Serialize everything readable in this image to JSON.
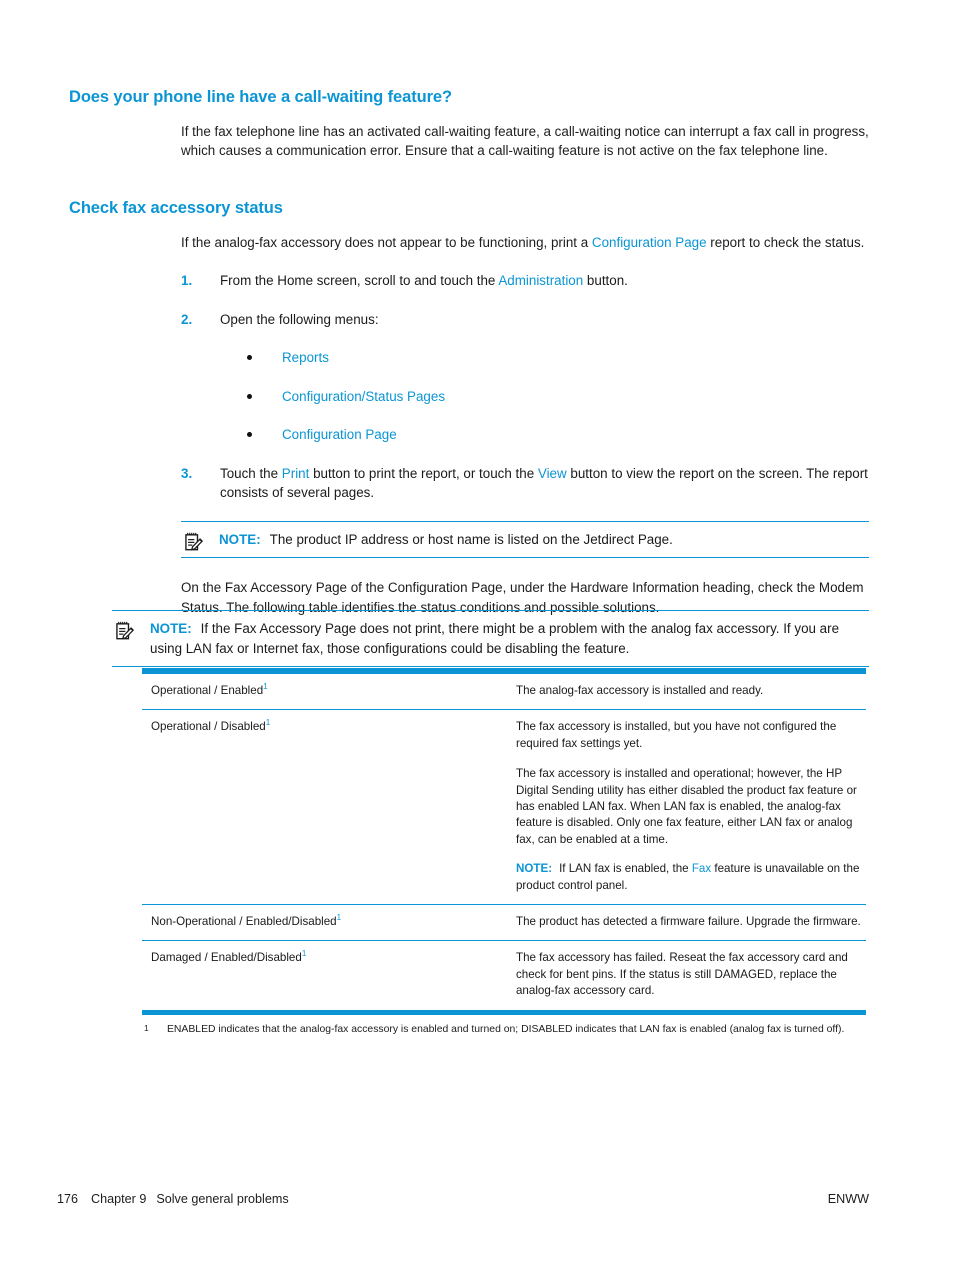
{
  "sections": [
    {
      "heading": "Does your phone line have a call-waiting feature?",
      "paragraph": "If the fax telephone line has an activated call-waiting feature, a call-waiting notice can interrupt a fax call in progress, which causes a communication error. Ensure that a call-waiting feature is not active on the fax telephone line."
    },
    {
      "heading": "Check fax accessory status",
      "intro_before": "If the analog-fax accessory does not appear to be functioning, print a ",
      "intro_link": "Configuration Page",
      "intro_after": " report to check the status."
    }
  ],
  "steps": [
    {
      "num": "1.",
      "text_before": "From the Home screen, scroll to and touch the ",
      "link": "Administration",
      "text_after": " button."
    },
    {
      "num": "2.",
      "text_before": "Open the following menus:",
      "link": "",
      "text_after": "",
      "bullets": [
        "Reports",
        "Configuration/Status Pages",
        "Configuration Page"
      ]
    },
    {
      "num": "3.",
      "text_before": "Touch the ",
      "link": "Print",
      "text_mid": " button to print the report, or touch the ",
      "link2": "View",
      "text_after": " button to view the report on the screen. The report consists of several pages."
    }
  ],
  "note1": {
    "label": "NOTE:",
    "text": "The product IP address or host name is listed on the Jetdirect Page.",
    "icon": "note-pad-pencil-icon"
  },
  "mid_paragraph": "On the Fax Accessory Page of the Configuration Page, under the Hardware Information heading, check the Modem Status. The following table identifies the status conditions and possible solutions.",
  "note2": {
    "label": "NOTE:",
    "text": "If the Fax Accessory Page does not print, there might be a problem with the analog fax accessory. If you are using LAN fax or Internet fax, those configurations could be disabling the feature.",
    "icon": "note-pad-pencil-icon"
  },
  "table": {
    "rows": [
      {
        "status": "Operational / Enabled",
        "footnote_marker": "1",
        "desc": "The analog-fax accessory is installed and ready.",
        "desc2": "",
        "note": null
      },
      {
        "status": "Operational / Disabled",
        "footnote_marker": "1",
        "desc": "The fax accessory is installed, but you have not configured the required fax settings yet.",
        "desc2": "The fax accessory is installed and operational; however, the HP Digital Sending utility has either disabled the product fax feature or has enabled LAN fax. When LAN fax is enabled, the analog-fax feature is disabled. Only one fax feature, either LAN fax or analog fax, can be enabled at a time.",
        "note": {
          "label": "NOTE:",
          "before": "If LAN fax is enabled, the ",
          "link": "Fax",
          "after": " feature is unavailable on the product control panel."
        }
      },
      {
        "status": "Non-Operational / Enabled/Disabled",
        "footnote_marker": "1",
        "desc": "The product has detected a firmware failure. Upgrade the firmware.",
        "desc2": "",
        "note": null
      },
      {
        "status": "Damaged / Enabled/Disabled",
        "footnote_marker": "1",
        "desc": "The fax accessory has failed. Reseat the fax accessory card and check for bent pins. If the status is still DAMAGED, replace the analog-fax accessory card.",
        "desc2": "",
        "note": null
      }
    ],
    "footnote": {
      "marker": "1",
      "text": "ENABLED indicates that the analog-fax accessory is enabled and turned on; DISABLED indicates that LAN fax is enabled (analog fax is turned off)."
    }
  },
  "footer": {
    "page_number": "176",
    "chapter": "Chapter 9",
    "chapter_title": "Solve general problems",
    "right": "ENWW"
  },
  "colors": {
    "accent_blue": "#0b95d4",
    "text": "#1d1d1d"
  }
}
